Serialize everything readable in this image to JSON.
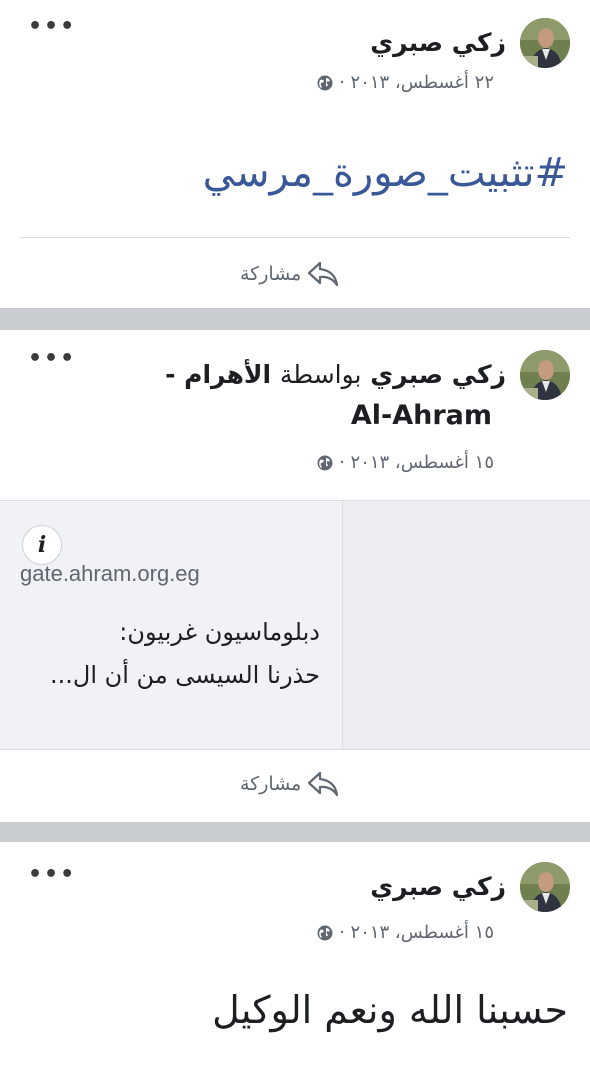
{
  "posts": [
    {
      "author": "زكي صبري",
      "date": "٢٢ أغسطس، ٢٠١٣ ·",
      "hashtag": "#تثبيت_صورة_مرسي",
      "share_label": "مشاركة",
      "more_label": "•••"
    },
    {
      "author": "زكي صبري",
      "via": "بواسطة",
      "page_name": "الأهرام -",
      "page_name_line2": "Al-Ahram",
      "date": "١٥ أغسطس، ٢٠١٣ ·",
      "link": {
        "domain": "gate.ahram.org.eg",
        "title_line1": "دبلوماسيون غربيون:",
        "title_line2": "حذرنا السيسى من أن ال...",
        "info_label": "i"
      },
      "share_label": "مشاركة",
      "more_label": "•••"
    },
    {
      "author": "زكي صبري",
      "date": "١٥ أغسطس، ٢٠١٣ ·",
      "text": "حسبنا الله ونعم الوكيل",
      "more_label": "•••"
    }
  ],
  "colors": {
    "separator": "#c9ccd1",
    "hashtag": "#385898",
    "meta": "#606770",
    "link_card_bg": "#f0f2f5"
  },
  "icons": [
    "globe-icon",
    "share-icon",
    "more-icon",
    "info-icon",
    "avatar"
  ]
}
